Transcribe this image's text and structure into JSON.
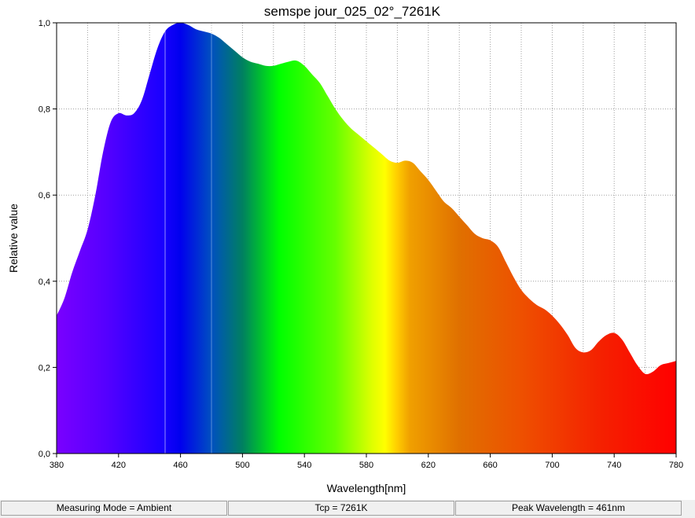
{
  "chart_data": {
    "type": "area",
    "title": "semspe jour_025_02°_7261K",
    "xlabel": "Wavelength[nm]",
    "ylabel": "Relative value",
    "xlim": [
      380,
      780
    ],
    "ylim": [
      0,
      1.0
    ],
    "x_ticks": [
      "380",
      "420",
      "460",
      "500",
      "540",
      "580",
      "620",
      "660",
      "700",
      "740",
      "780"
    ],
    "y_ticks": [
      "0,0",
      "0,2",
      "0,4",
      "0,6",
      "0,8",
      "1,0"
    ],
    "grid": "dotted",
    "fill": "visible-spectrum",
    "series": [
      {
        "x": [
          380,
          385,
          390,
          395,
          400,
          405,
          410,
          415,
          420,
          425,
          430,
          435,
          440,
          445,
          450,
          455,
          460,
          465,
          470,
          475,
          480,
          485,
          490,
          495,
          500,
          505,
          510,
          515,
          520,
          525,
          530,
          535,
          540,
          545,
          550,
          555,
          560,
          565,
          570,
          575,
          580,
          585,
          590,
          595,
          600,
          605,
          610,
          615,
          620,
          625,
          630,
          635,
          640,
          645,
          650,
          655,
          660,
          665,
          670,
          675,
          680,
          685,
          690,
          695,
          700,
          705,
          710,
          715,
          720,
          725,
          730,
          735,
          740,
          745,
          750,
          755,
          760,
          765,
          770,
          775,
          780
        ],
        "y": [
          0.32,
          0.36,
          0.42,
          0.47,
          0.52,
          0.6,
          0.7,
          0.77,
          0.79,
          0.785,
          0.79,
          0.82,
          0.88,
          0.94,
          0.98,
          0.995,
          1.0,
          0.995,
          0.985,
          0.98,
          0.975,
          0.965,
          0.95,
          0.935,
          0.92,
          0.91,
          0.905,
          0.9,
          0.9,
          0.905,
          0.91,
          0.912,
          0.9,
          0.88,
          0.86,
          0.83,
          0.8,
          0.775,
          0.755,
          0.74,
          0.725,
          0.71,
          0.695,
          0.68,
          0.675,
          0.68,
          0.675,
          0.655,
          0.635,
          0.61,
          0.585,
          0.57,
          0.55,
          0.53,
          0.51,
          0.5,
          0.495,
          0.48,
          0.445,
          0.41,
          0.38,
          0.36,
          0.345,
          0.335,
          0.32,
          0.3,
          0.275,
          0.245,
          0.235,
          0.24,
          0.26,
          0.275,
          0.28,
          0.265,
          0.235,
          0.205,
          0.185,
          0.19,
          0.205,
          0.21,
          0.215
        ]
      }
    ]
  },
  "status_bar": {
    "measuring_mode": "Measuring Mode = Ambient",
    "tcp": "Tcp = 7261K",
    "peak_wavelength": "Peak Wavelength = 461nm"
  }
}
